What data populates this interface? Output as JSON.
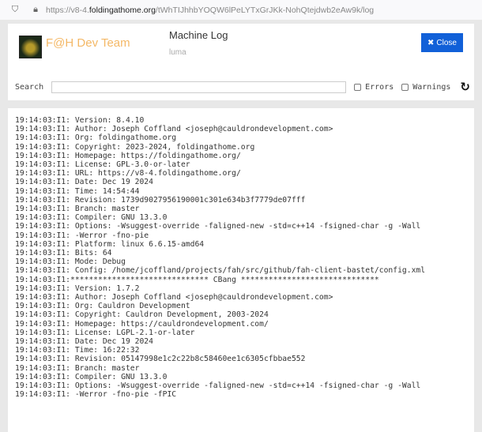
{
  "browser": {
    "url_prefix": "https://v8-4.",
    "url_domain": "foldingathome.org",
    "url_path": "/tWhTIJhhbYOQW6lPeLYTxGrJKk-NohQtejdwb2eAw9k/log"
  },
  "header": {
    "team": "F@H Dev Team",
    "title": "Machine Log",
    "subtitle": "luma",
    "close_label": "Close",
    "close_color": "#1160d8"
  },
  "search": {
    "label": "Search",
    "value": "",
    "errors_label": "Errors",
    "warnings_label": "Warnings",
    "errors_checked": false,
    "warnings_checked": false
  },
  "log": {
    "lines": [
      "19:14:03:I1: Version: 8.4.10",
      "19:14:03:I1: Author: Joseph Coffland <joseph@cauldrondevelopment.com>",
      "19:14:03:I1: Org: foldingathome.org",
      "19:14:03:I1: Copyright: 2023-2024, foldingathome.org",
      "19:14:03:I1: Homepage: https://foldingathome.org/",
      "19:14:03:I1: License: GPL-3.0-or-later",
      "19:14:03:I1: URL: https://v8-4.foldingathome.org/",
      "19:14:03:I1: Date: Dec 19 2024",
      "19:14:03:I1: Time: 14:54:44",
      "19:14:03:I1: Revision: 1739d9027956190001c301e634b3f7779de07fff",
      "19:14:03:I1: Branch: master",
      "19:14:03:I1: Compiler: GNU 13.3.0",
      "19:14:03:I1: Options: -Wsuggest-override -faligned-new -std=c++14 -fsigned-char -g -Wall",
      "19:14:03:I1: -Werror -fno-pie",
      "19:14:03:I1: Platform: linux 6.6.15-amd64",
      "19:14:03:I1: Bits: 64",
      "19:14:03:I1: Mode: Debug",
      "19:14:03:I1: Config: /home/jcoffland/projects/fah/src/github/fah-client-bastet/config.xml",
      "19:14:03:I1:****************************** CBang ******************************",
      "19:14:03:I1: Version: 1.7.2",
      "19:14:03:I1: Author: Joseph Coffland <joseph@cauldrondevelopment.com>",
      "19:14:03:I1: Org: Cauldron Development",
      "19:14:03:I1: Copyright: Cauldron Development, 2003-2024",
      "19:14:03:I1: Homepage: https://cauldrondevelopment.com/",
      "19:14:03:I1: License: LGPL-2.1-or-later",
      "19:14:03:I1: Date: Dec 19 2024",
      "19:14:03:I1: Time: 16:22:32",
      "19:14:03:I1: Revision: 05147998e1c2c22b8c58460ee1c6305cfbbae552",
      "19:14:03:I1: Branch: master",
      "19:14:03:I1: Compiler: GNU 13.3.0",
      "19:14:03:I1: Options: -Wsuggest-override -faligned-new -std=c++14 -fsigned-char -g -Wall",
      "19:14:03:I1: -Werror -fno-pie -fPIC"
    ]
  }
}
